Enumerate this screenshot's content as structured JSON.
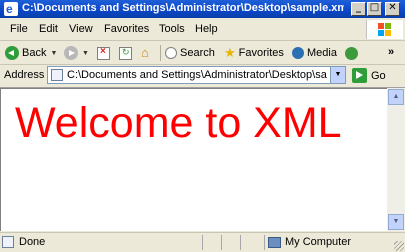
{
  "window": {
    "title": "C:\\Documents and Settings\\Administrator\\Desktop\\sample.xm...",
    "controls": {
      "minimize": "_",
      "maximize": "□",
      "close": "✕"
    }
  },
  "menu": {
    "items": [
      {
        "label": "File"
      },
      {
        "label": "Edit"
      },
      {
        "label": "View"
      },
      {
        "label": "Favorites"
      },
      {
        "label": "Tools"
      },
      {
        "label": "Help"
      }
    ]
  },
  "toolbar": {
    "back_label": "Back",
    "search_label": "Search",
    "favorites_label": "Favorites",
    "media_label": "Media",
    "overflow": "»"
  },
  "address": {
    "label": "Address",
    "url": "C:\\Documents and Settings\\Administrator\\Desktop\\sample.xml",
    "go_label": "Go"
  },
  "content": {
    "heading": "Welcome to XML",
    "heading_color": "#ff0000"
  },
  "status": {
    "text": "Done",
    "zone": "My Computer"
  },
  "colors": {
    "titlebar": "#0b46c8",
    "chrome": "#ece9d8"
  }
}
